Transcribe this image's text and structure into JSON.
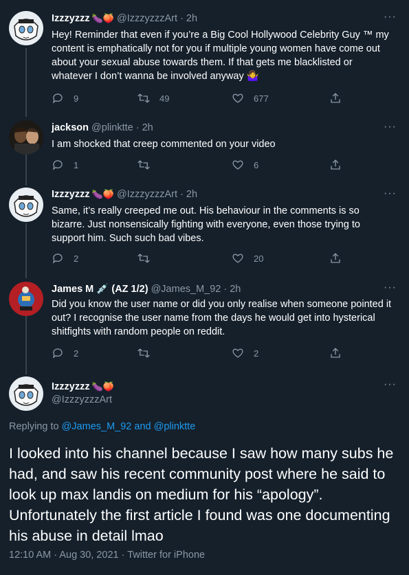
{
  "colors": {
    "background": "#15202b",
    "secondary_text": "#8b98a5",
    "link": "#1d9bf0",
    "divider": "#38444d"
  },
  "tweets": [
    {
      "name": "Izzzyzzz",
      "name_emojis": "🍆🍑",
      "handle": "@IzzzyzzzArt",
      "time": "· 2h",
      "text": "Hey! Reminder that even if you’re a Big Cool Hollywood Celebrity Guy ™ my content is emphatically not for you if multiple young women have come out about your sexual abuse towards them. If that gets me blacklisted or whatever I don’t wanna be involved anyway 🤷‍♀️",
      "replies": "9",
      "retweets": "49",
      "likes": "677"
    },
    {
      "name": "jackson",
      "name_emojis": "",
      "handle": "@plinktte",
      "time": "· 2h",
      "text": "I am shocked that creep commented on your video",
      "replies": "1",
      "retweets": "",
      "likes": "6"
    },
    {
      "name": "Izzzyzzz",
      "name_emojis": "🍆🍑",
      "handle": "@IzzzyzzzArt",
      "time": "· 2h",
      "text": "Same, it’s really creeped me out. His behaviour in the comments is so bizarre. Just nonsensically fighting with everyone, even those trying to support him. Such such bad vibes.",
      "replies": "2",
      "retweets": "",
      "likes": "20"
    },
    {
      "name": "James M 💉 (AZ 1/2)",
      "name_emojis": "",
      "handle": "@James_M_92",
      "time": "· 2h",
      "text": "Did you know the user name or did you only realise when someone pointed it out? I recognise the user name from the days he would get into hysterical shitfights with random people on reddit.",
      "replies": "2",
      "retweets": "",
      "likes": "2"
    }
  ],
  "main_tweet": {
    "name": "Izzzyzzz",
    "name_emojis": "🍆🍑",
    "handle": "@IzzzyzzzArt",
    "replying_prefix": "Replying to",
    "replying_user1": "@James_M_92",
    "replying_and": "and",
    "replying_user2": "@plinktte",
    "text": "I looked into his channel because I saw how many subs he had, and saw his recent community post where he said to look up max landis on medium for his “apology”. Unfortunately the first article I found was one documenting his abuse in detail lmao",
    "meta": "12:10 AM · Aug 30, 2021 · Twitter for iPhone",
    "more": "···"
  }
}
